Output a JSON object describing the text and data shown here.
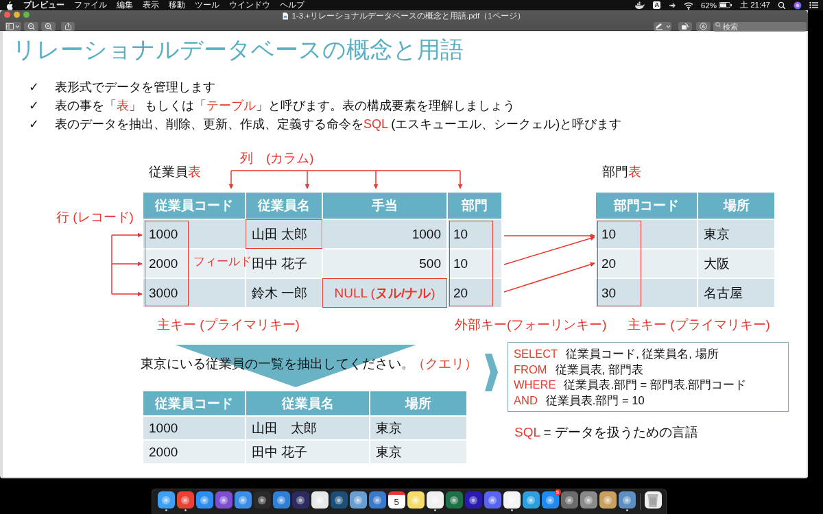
{
  "menu_bar": {
    "app_name": "プレビュー",
    "menus": [
      "ファイル",
      "編集",
      "表示",
      "移動",
      "ツール",
      "ウインドウ",
      "ヘルプ"
    ],
    "input_source": "A",
    "battery": "62%",
    "clock": "土 21:47"
  },
  "window": {
    "title": "1-3.+リレーショナルデータベースの概念と用語.pdf（1ページ）",
    "search": {
      "placeholder": "検索"
    }
  },
  "slide": {
    "title": "リレーショナルデータベースの概念と用語",
    "bullets": [
      {
        "check": "✓",
        "segments": [
          {
            "text": "表形式でデータを管理します",
            "accent": false
          }
        ]
      },
      {
        "check": "✓",
        "segments": [
          {
            "text": "表の事を「",
            "accent": false
          },
          {
            "text": "表",
            "accent": true
          },
          {
            "text": "」 もしくは「",
            "accent": false
          },
          {
            "text": "テーブル",
            "accent": true
          },
          {
            "text": "」と呼びます。表の構成要素を理解しましょう",
            "accent": false
          }
        ]
      },
      {
        "check": "✓",
        "segments": [
          {
            "text": "表のデータを抽出、削除、更新、作成、定義する命令を",
            "accent": false
          },
          {
            "text": "SQL",
            "accent": true
          },
          {
            "text": " (エスキューエル、シークェル)と呼びます",
            "accent": false
          }
        ]
      }
    ],
    "column_label": "列　(カラム)",
    "row_label": "行 (レコード)",
    "field_label": "フィールド",
    "employee_table": {
      "title": [
        {
          "text": "従業員",
          "accent": false
        },
        {
          "text": "表",
          "accent": true
        }
      ],
      "columns": [
        {
          "label": "従業員コード",
          "outlined": true,
          "numeric": false
        },
        {
          "label": "従業員名",
          "outlined": false,
          "numeric": false
        },
        {
          "label": "手当",
          "outlined": false,
          "numeric": true
        },
        {
          "label": "部門",
          "outlined": true,
          "numeric": false
        }
      ],
      "rows": [
        [
          {
            "text": "1000",
            "outlined": false,
            "accent": false
          },
          {
            "text": "山田 太郎",
            "outlined": true,
            "accent": false
          },
          {
            "text": "1000",
            "outlined": false,
            "accent": false
          },
          {
            "text": "10",
            "outlined": false,
            "accent": false
          }
        ],
        [
          {
            "text": "2000",
            "outlined": false,
            "accent": false
          },
          {
            "text": "田中 花子",
            "outlined": false,
            "accent": false
          },
          {
            "text": "500",
            "outlined": false,
            "accent": false
          },
          {
            "text": "10",
            "outlined": false,
            "accent": false
          }
        ],
        [
          {
            "text": "3000",
            "outlined": false,
            "accent": false
          },
          {
            "text": "鈴木 一郎",
            "outlined": false,
            "accent": false
          },
          {
            "text": "NULL (**ヌル/ナル**)",
            "outlined": true,
            "accent": true
          },
          {
            "text": "20",
            "outlined": false,
            "accent": false
          }
        ]
      ]
    },
    "department_table": {
      "title": [
        {
          "text": "部門",
          "accent": false
        },
        {
          "text": "表",
          "accent": true
        }
      ],
      "columns": [
        {
          "label": "部門コード",
          "outlined": true,
          "numeric": false
        },
        {
          "label": "場所",
          "outlined": false,
          "numeric": false
        }
      ],
      "rows": [
        [
          {
            "text": "10",
            "outlined": false,
            "accent": false
          },
          {
            "text": "東京",
            "outlined": false,
            "accent": false
          }
        ],
        [
          {
            "text": "20",
            "outlined": false,
            "accent": false
          },
          {
            "text": "大阪",
            "outlined": false,
            "accent": false
          }
        ],
        [
          {
            "text": "30",
            "outlined": false,
            "accent": false
          },
          {
            "text": "名古屋",
            "outlined": false,
            "accent": false
          }
        ]
      ]
    },
    "key_labels": [
      "主キー (プライマリキー)",
      "外部キー(フォーリンキー)",
      "主キー (プライマリキー)"
    ],
    "query": {
      "text": "東京にいる従業員の一覧を抽出してください。",
      "note": "（クエリ）"
    },
    "result_table": {
      "columns": [
        {
          "label": "従業員コード",
          "outlined": false,
          "numeric": false
        },
        {
          "label": "従業員名",
          "outlined": false,
          "numeric": false
        },
        {
          "label": "場所",
          "outlined": false,
          "numeric": false
        }
      ],
      "rows": [
        [
          {
            "text": "1000",
            "outlined": false,
            "accent": false
          },
          {
            "text": "山田　太郎",
            "outlined": false,
            "accent": false
          },
          {
            "text": "東京",
            "outlined": false,
            "accent": false
          }
        ],
        [
          {
            "text": "2000",
            "outlined": false,
            "accent": false
          },
          {
            "text": "田中 花子",
            "outlined": false,
            "accent": false
          },
          {
            "text": "東京",
            "outlined": false,
            "accent": false
          }
        ]
      ]
    },
    "sql": [
      {
        "keyword": "SELECT",
        "text": "従業員コード, 従業員名, 場所"
      },
      {
        "keyword": "FROM",
        "text": "従業員表, 部門表"
      },
      {
        "keyword": "WHERE",
        "text": "従業員表.部門 = 部門表.部門コード"
      },
      {
        "keyword": "AND",
        "text": "従業員表.部門 = 10"
      }
    ],
    "sql_note": {
      "keyword": "SQL",
      "text": "= データを扱うための言語"
    }
  },
  "dock": [
    {
      "kind": "app",
      "color": "#3f9ff0",
      "running": true
    },
    {
      "kind": "app",
      "color": "#e94235",
      "running": true
    },
    {
      "kind": "app",
      "color": "#2b8ef0",
      "running": false
    },
    {
      "kind": "app",
      "color": "#7b4fd0",
      "running": false
    },
    {
      "kind": "app",
      "color": "#3b8de6",
      "running": false
    },
    {
      "kind": "app",
      "color": "#2a2a2a",
      "running": false
    },
    {
      "kind": "app",
      "color": "#2f7fd8",
      "running": false
    },
    {
      "kind": "app",
      "color": "#2c2a5e",
      "running": false
    },
    {
      "kind": "app",
      "color": "#e8e8e8",
      "running": false
    },
    {
      "kind": "app",
      "color": "#1b4f78",
      "running": false
    },
    {
      "kind": "app",
      "color": "#6a9ed0",
      "running": false
    },
    {
      "kind": "app",
      "color": "#3a78c8",
      "running": false
    },
    {
      "kind": "calendar",
      "color": "#ffffff",
      "text": "5",
      "running": false
    },
    {
      "kind": "app",
      "color": "#f5dc6a",
      "running": false
    },
    {
      "kind": "app",
      "color": "#f0f0f0",
      "running": true
    },
    {
      "kind": "app",
      "color": "#1e7145",
      "running": false
    },
    {
      "kind": "app",
      "color": "#2a1ab0",
      "running": false
    },
    {
      "kind": "app",
      "color": "#5865f2",
      "running": false
    },
    {
      "kind": "app",
      "color": "#f4f4f4",
      "running": true
    },
    {
      "kind": "app",
      "color": "#2aa0e0",
      "running": false
    },
    {
      "kind": "app",
      "color": "#1c8cf0",
      "badge": "5",
      "running": false
    },
    {
      "kind": "app",
      "color": "#6b6b6b",
      "running": false
    },
    {
      "kind": "app",
      "color": "#8a8a8a",
      "running": false
    },
    {
      "kind": "app",
      "color": "#c8a060",
      "running": false
    },
    {
      "kind": "app",
      "color": "#5f8fc0",
      "running": true
    },
    {
      "kind": "trash",
      "color": "#b5b5b5",
      "running": false
    }
  ]
}
